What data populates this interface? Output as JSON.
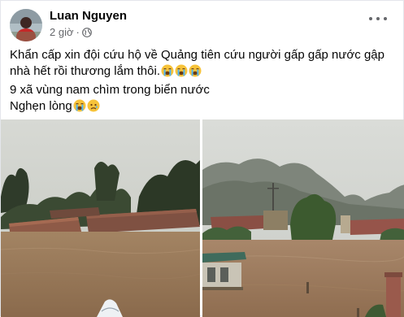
{
  "post": {
    "author": "Luan Nguyen",
    "time": "2 giờ",
    "separator": "·",
    "privacy_icon": "globe-icon",
    "menu_icon": "more-options-icon",
    "lines": [
      "Khẩn cấp xin đội cứu hộ về Quảng tiên cứu người gấp gấp nước gập",
      "nhà hết rồi thương lắm thôi.",
      "9 xã vùng nam chìm trong biển nước",
      "Nghẹn lòng"
    ],
    "emoji": {
      "crying": "loudly-crying-face-emoji",
      "sad": "sad-face-emoji"
    },
    "photos": [
      {
        "subject": "flooded village with submerged roofs and trees"
      },
      {
        "subject": "flooded village with limestone mountains in background"
      }
    ]
  }
}
